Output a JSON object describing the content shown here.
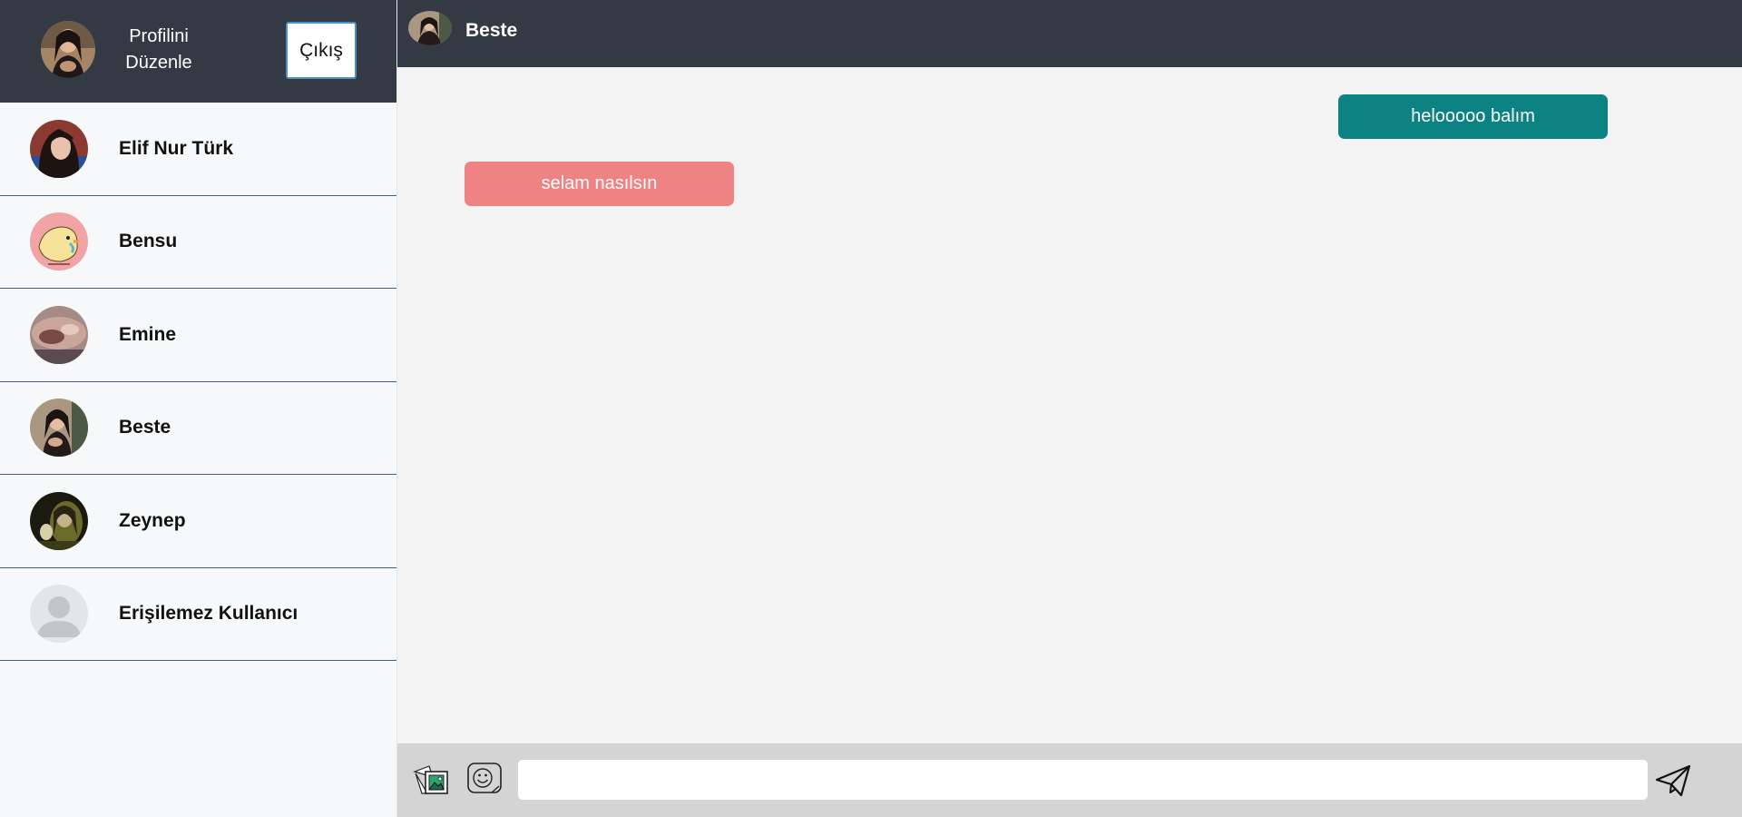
{
  "sidebar": {
    "header": {
      "edit_profile_line1": "Profilini",
      "edit_profile_line2": "Düzenle",
      "logout_label": "Çıkış"
    },
    "contacts": [
      {
        "name": "Elif Nur Türk",
        "avatar": "photo-dark-hair"
      },
      {
        "name": "Bensu",
        "avatar": "cartoon-chick-pink"
      },
      {
        "name": "Emine",
        "avatar": "photo-closeup"
      },
      {
        "name": "Beste",
        "avatar": "photo-portrait"
      },
      {
        "name": "Zeynep",
        "avatar": "photo-dark-green"
      },
      {
        "name": "Erişilemez Kullanıcı",
        "avatar": "default-user-icon"
      }
    ]
  },
  "chat": {
    "header": {
      "title": "Beste"
    },
    "messages": [
      {
        "side": "sent",
        "text": "helooooo balım"
      },
      {
        "side": "received",
        "text": "selam nasılsın"
      }
    ],
    "composer": {
      "input_value": "",
      "placeholder": "",
      "icons": [
        "image-upload-icon",
        "emoji-icon",
        "send-icon"
      ]
    }
  },
  "colors": {
    "header_bg": "#343a43",
    "sent_bubble": "#0d8282",
    "received_bubble": "#ef8383",
    "sidebar_bg": "#f6f8fa",
    "chat_bg": "#f2f3f2",
    "composer_bg": "#d4d4d4",
    "divider": "#3c6287"
  }
}
